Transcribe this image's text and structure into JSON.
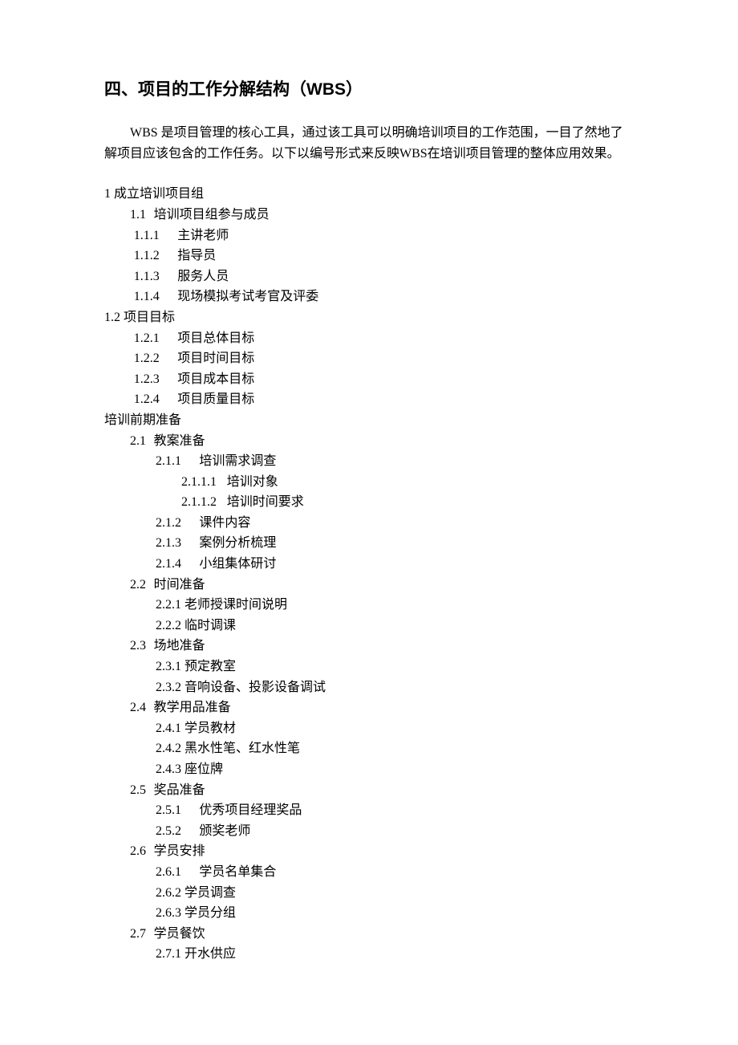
{
  "title": "四、项目的工作分解结构（WBS）",
  "intro": "WBS 是项目管理的核心工具，通过该工具可以明确培训项目的工作范围，一目了然地了解项目应该包含的工作任务。以下以编号形式来反映WBS在培训项目管理的整体应用效果。",
  "items": {
    "s1": "1 成立培训项目组",
    "s1_1": "1.1",
    "s1_1t": "培训项目组参与成员",
    "s1_1_1": "1.1.1",
    "s1_1_1t": "主讲老师",
    "s1_1_2": "1.1.2",
    "s1_1_2t": "指导员",
    "s1_1_3": "1.1.3",
    "s1_1_3t": "服务人员",
    "s1_1_4": "1.1.4",
    "s1_1_4t": "现场模拟考试考官及评委",
    "s1_2": "1.2 项目目标",
    "s1_2_1": "1.2.1",
    "s1_2_1t": "项目总体目标",
    "s1_2_2": "1.2.2",
    "s1_2_2t": "项目时间目标",
    "s1_2_3": "1.2.3",
    "s1_2_3t": "项目成本目标",
    "s1_2_4": "1.2.4",
    "s1_2_4t": "项目质量目标",
    "s2": "培训前期准备",
    "s2_1": "2.1",
    "s2_1t": "教案准备",
    "s2_1_1": "2.1.1",
    "s2_1_1t": "培训需求调查",
    "s2_1_1_1": "2.1.1.1",
    "s2_1_1_1t": "培训对象",
    "s2_1_1_2": "2.1.1.2",
    "s2_1_1_2t": "培训时间要求",
    "s2_1_2": "2.1.2",
    "s2_1_2t": "课件内容",
    "s2_1_3": "2.1.3",
    "s2_1_3t": "案例分析梳理",
    "s2_1_4": "2.1.4",
    "s2_1_4t": "小组集体研讨",
    "s2_2": "2.2",
    "s2_2t": "时间准备",
    "s2_2_1": "2.2.1 老师授课时间说明",
    "s2_2_2": "2.2.2 临时调课",
    "s2_3": "2.3",
    "s2_3t": "场地准备",
    "s2_3_1": "2.3.1 预定教室",
    "s2_3_2": "2.3.2 音响设备、投影设备调试",
    "s2_4": "2.4",
    "s2_4t": "教学用品准备",
    "s2_4_1": "2.4.1 学员教材",
    "s2_4_2": "2.4.2 黑水性笔、红水性笔",
    "s2_4_3": "2.4.3 座位牌",
    "s2_5": "2.5",
    "s2_5t": "奖品准备",
    "s2_5_1": "2.5.1",
    "s2_5_1t": "优秀项目经理奖品",
    "s2_5_2": "2.5.2",
    "s2_5_2t": "颁奖老师",
    "s2_6": "2.6",
    "s2_6t": "学员安排",
    "s2_6_1": "2.6.1",
    "s2_6_1t": "学员名单集合",
    "s2_6_2": "2.6.2 学员调查",
    "s2_6_3": "2.6.3 学员分组",
    "s2_7": "2.7",
    "s2_7t": "学员餐饮",
    "s2_7_1": "2.7.1 开水供应"
  }
}
